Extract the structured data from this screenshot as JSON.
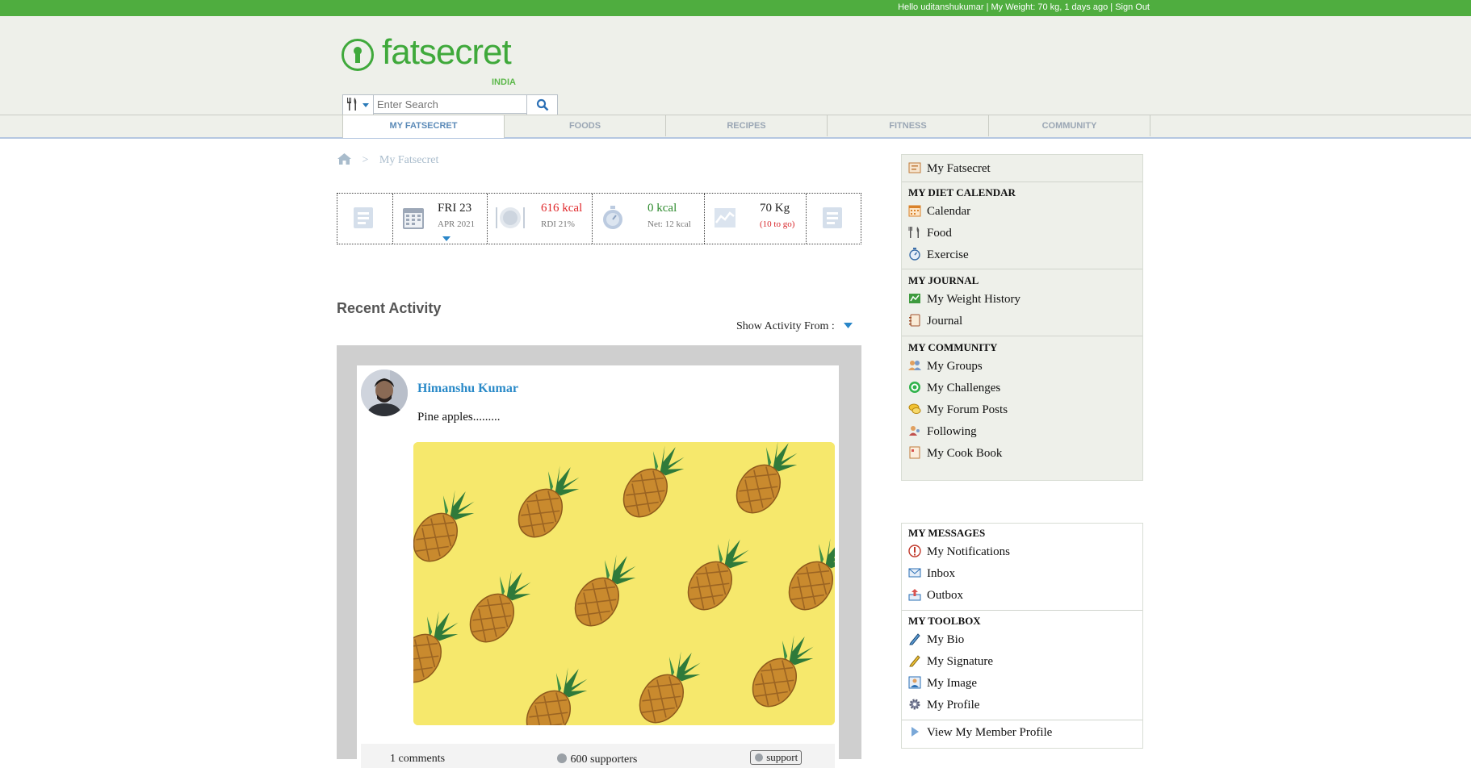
{
  "topbar": {
    "greeting": "Hello uditanshukumar",
    "weight": "My Weight: 70 kg, 1 days ago",
    "signout": "Sign Out",
    "sep": "|"
  },
  "logo": {
    "word": "fatsecret",
    "country": "INDIA"
  },
  "search": {
    "placeholder": "Enter Search"
  },
  "nav": {
    "tabs": [
      "MY FATSECRET",
      "FOODS",
      "RECIPES",
      "FITNESS",
      "COMMUNITY"
    ]
  },
  "breadcrumb": {
    "sep": ">",
    "current": "My Fatsecret"
  },
  "dashboard": {
    "day": "FRI 23",
    "month": "APR 2021",
    "food_kcal": "616 kcal",
    "food_rdi": "RDI 21%",
    "exercise_kcal": "0 kcal",
    "exercise_net": "Net: 12 kcal",
    "weight": "70 Kg",
    "weight_goal": "(10 to go)",
    "colors": {
      "food": "#e0282b",
      "exercise": "#2e8b2e",
      "goal": "#d8262a"
    }
  },
  "recent": {
    "title": "Recent Activity",
    "show_from": "Show Activity From :"
  },
  "post": {
    "user": "Himanshu Kumar",
    "text": "Pine apples.........",
    "comments": "1 comments",
    "supporters": "600 supporters",
    "support_btn": "support"
  },
  "sidebar": {
    "my_fatsecret": "My Fatsecret",
    "diet_calendar": {
      "head": "MY DIET CALENDAR",
      "items": [
        "Calendar",
        "Food",
        "Exercise"
      ]
    },
    "journal": {
      "head": "MY JOURNAL",
      "items": [
        "My Weight History",
        "Journal"
      ]
    },
    "community": {
      "head": "MY COMMUNITY",
      "items": [
        "My Groups",
        "My Challenges",
        "My Forum Posts",
        "Following",
        "My Cook Book"
      ]
    },
    "messages": {
      "head": "MY MESSAGES",
      "items": [
        "My Notifications",
        "Inbox",
        "Outbox"
      ]
    },
    "toolbox": {
      "head": "MY TOOLBOX",
      "items": [
        "My Bio",
        "My Signature",
        "My Image",
        "My Profile"
      ]
    },
    "member_profile": "View My Member Profile"
  }
}
